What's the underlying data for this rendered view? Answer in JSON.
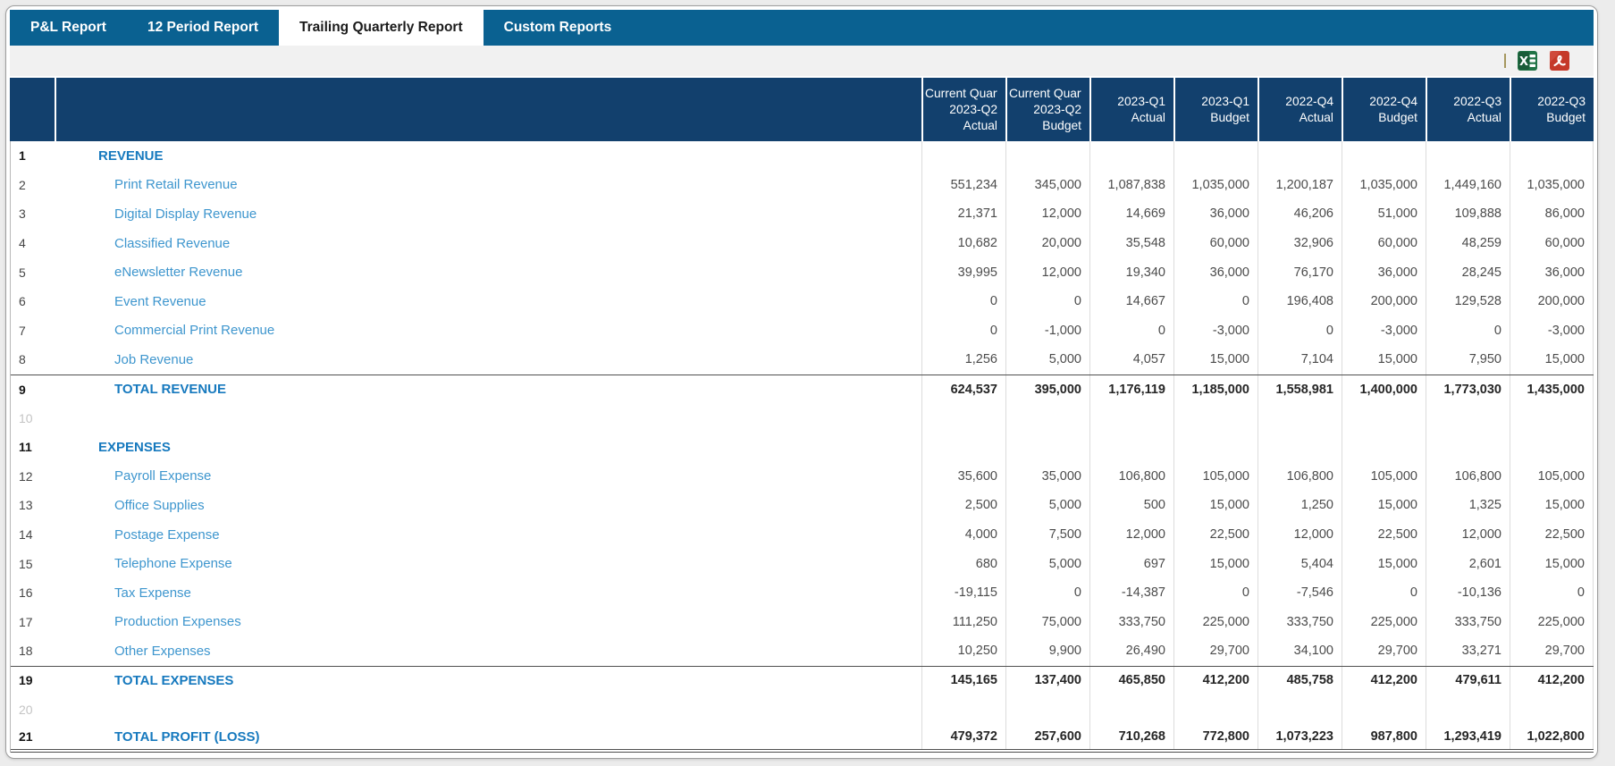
{
  "tabs": [
    {
      "label": "P&L Report",
      "active": false
    },
    {
      "label": "12 Period Report",
      "active": false
    },
    {
      "label": "Trailing Quarterly Report",
      "active": true
    },
    {
      "label": "Custom Reports",
      "active": false
    }
  ],
  "toolbar": {
    "icons": [
      "excel-export-icon",
      "pdf-export-icon"
    ]
  },
  "colors": {
    "tab_bar": "#0A6191",
    "table_header": "#12406D",
    "item_link": "#3E96CE",
    "bold_link": "#1679BE",
    "excel_green": "#217346",
    "pdf_red": "#C53929"
  },
  "table": {
    "columns": [
      {
        "line1": "Current Quarter",
        "line2": "2023-Q2",
        "line3": "Actual"
      },
      {
        "line1": "Current Quarter",
        "line2": "2023-Q2",
        "line3": "Budget"
      },
      {
        "line2": "2023-Q1",
        "line3": "Actual"
      },
      {
        "line2": "2023-Q1",
        "line3": "Budget"
      },
      {
        "line2": "2022-Q4",
        "line3": "Actual"
      },
      {
        "line2": "2022-Q4",
        "line3": "Budget"
      },
      {
        "line2": "2022-Q3",
        "line3": "Actual"
      },
      {
        "line2": "2022-Q3",
        "line3": "Budget"
      }
    ],
    "rows": [
      {
        "num": "1",
        "label": "REVENUE",
        "type": "section",
        "values": [
          "",
          "",
          "",
          "",
          "",
          "",
          "",
          ""
        ]
      },
      {
        "num": "2",
        "label": "Print Retail Revenue",
        "type": "item",
        "values": [
          "551,234",
          "345,000",
          "1,087,838",
          "1,035,000",
          "1,200,187",
          "1,035,000",
          "1,449,160",
          "1,035,000"
        ]
      },
      {
        "num": "3",
        "label": "Digital Display Revenue",
        "type": "item",
        "values": [
          "21,371",
          "12,000",
          "14,669",
          "36,000",
          "46,206",
          "51,000",
          "109,888",
          "86,000"
        ]
      },
      {
        "num": "4",
        "label": "Classified Revenue",
        "type": "item",
        "values": [
          "10,682",
          "20,000",
          "35,548",
          "60,000",
          "32,906",
          "60,000",
          "48,259",
          "60,000"
        ]
      },
      {
        "num": "5",
        "label": "eNewsletter Revenue",
        "type": "item",
        "values": [
          "39,995",
          "12,000",
          "19,340",
          "36,000",
          "76,170",
          "36,000",
          "28,245",
          "36,000"
        ]
      },
      {
        "num": "6",
        "label": "Event Revenue",
        "type": "item",
        "values": [
          "0",
          "0",
          "14,667",
          "0",
          "196,408",
          "200,000",
          "129,528",
          "200,000"
        ]
      },
      {
        "num": "7",
        "label": "Commercial Print Revenue",
        "type": "item",
        "values": [
          "0",
          "-1,000",
          "0",
          "-3,000",
          "0",
          "-3,000",
          "0",
          "-3,000"
        ]
      },
      {
        "num": "8",
        "label": "Job Revenue",
        "type": "item",
        "values": [
          "1,256",
          "5,000",
          "4,057",
          "15,000",
          "7,104",
          "15,000",
          "7,950",
          "15,000"
        ]
      },
      {
        "num": "9",
        "label": "TOTAL REVENUE",
        "type": "total",
        "rule": "top",
        "values": [
          "624,537",
          "395,000",
          "1,176,119",
          "1,185,000",
          "1,558,981",
          "1,400,000",
          "1,773,030",
          "1,435,000"
        ]
      },
      {
        "num": "10",
        "label": "",
        "type": "empty",
        "values": [
          "",
          "",
          "",
          "",
          "",
          "",
          "",
          ""
        ]
      },
      {
        "num": "11",
        "label": "EXPENSES",
        "type": "section",
        "values": [
          "",
          "",
          "",
          "",
          "",
          "",
          "",
          ""
        ]
      },
      {
        "num": "12",
        "label": "Payroll Expense",
        "type": "item",
        "values": [
          "35,600",
          "35,000",
          "106,800",
          "105,000",
          "106,800",
          "105,000",
          "106,800",
          "105,000"
        ]
      },
      {
        "num": "13",
        "label": "Office Supplies",
        "type": "item",
        "values": [
          "2,500",
          "5,000",
          "500",
          "15,000",
          "1,250",
          "15,000",
          "1,325",
          "15,000"
        ]
      },
      {
        "num": "14",
        "label": "Postage Expense",
        "type": "item",
        "values": [
          "4,000",
          "7,500",
          "12,000",
          "22,500",
          "12,000",
          "22,500",
          "12,000",
          "22,500"
        ]
      },
      {
        "num": "15",
        "label": "Telephone Expense",
        "type": "item",
        "values": [
          "680",
          "5,000",
          "697",
          "15,000",
          "5,404",
          "15,000",
          "2,601",
          "15,000"
        ]
      },
      {
        "num": "16",
        "label": "Tax Expense",
        "type": "item",
        "values": [
          "-19,115",
          "0",
          "-14,387",
          "0",
          "-7,546",
          "0",
          "-10,136",
          "0"
        ]
      },
      {
        "num": "17",
        "label": "Production Expenses",
        "type": "item",
        "values": [
          "111,250",
          "75,000",
          "333,750",
          "225,000",
          "333,750",
          "225,000",
          "333,750",
          "225,000"
        ]
      },
      {
        "num": "18",
        "label": "Other Expenses",
        "type": "item",
        "values": [
          "10,250",
          "9,900",
          "26,490",
          "29,700",
          "34,100",
          "29,700",
          "33,271",
          "29,700"
        ]
      },
      {
        "num": "19",
        "label": "TOTAL EXPENSES",
        "type": "total",
        "rule": "top",
        "values": [
          "145,165",
          "137,400",
          "465,850",
          "412,200",
          "485,758",
          "412,200",
          "479,611",
          "412,200"
        ]
      },
      {
        "num": "20",
        "label": "",
        "type": "empty",
        "values": [
          "",
          "",
          "",
          "",
          "",
          "",
          "",
          ""
        ]
      },
      {
        "num": "21",
        "label": "TOTAL PROFIT (LOSS)",
        "type": "total",
        "rule": "double-bottom",
        "values": [
          "479,372",
          "257,600",
          "710,268",
          "772,800",
          "1,073,223",
          "987,800",
          "1,293,419",
          "1,022,800"
        ]
      }
    ]
  }
}
